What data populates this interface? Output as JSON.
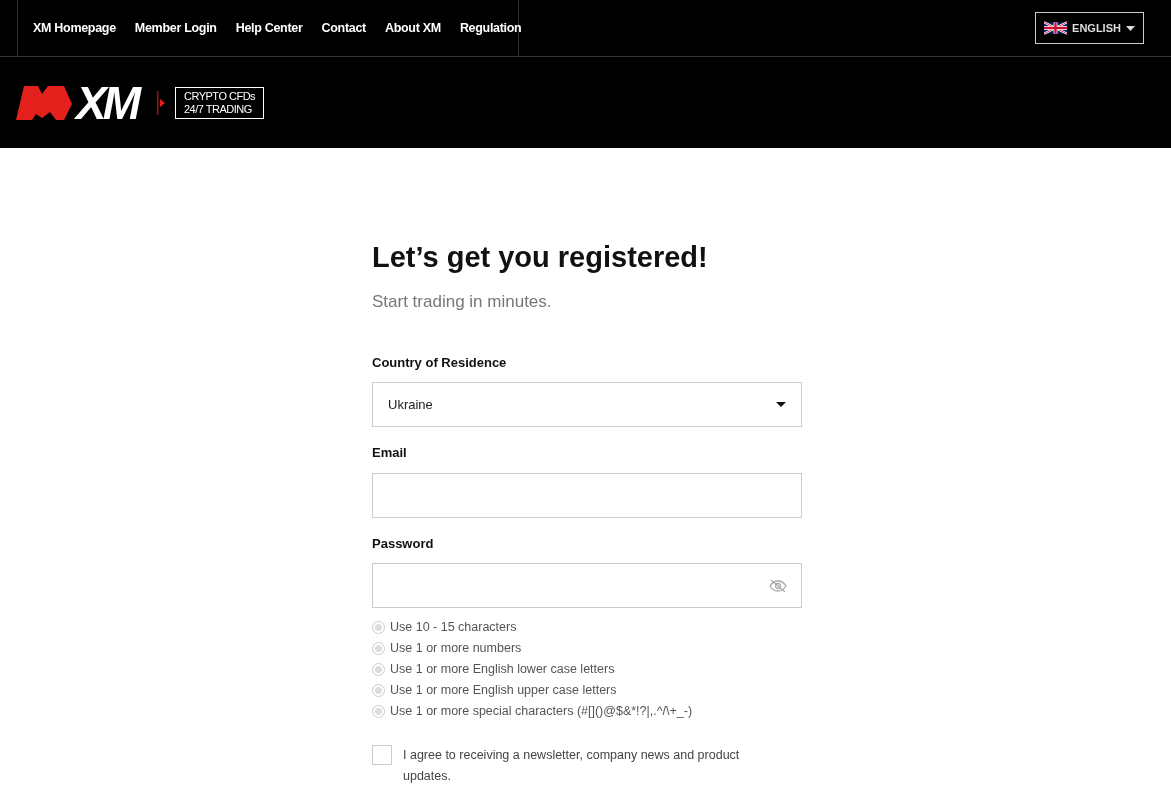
{
  "top_nav": {
    "links": [
      "XM Homepage",
      "Member Login",
      "Help Center",
      "Contact",
      "About XM",
      "Regulation"
    ],
    "language": "ENGLISH"
  },
  "header": {
    "logo": "XM",
    "badge_lines": [
      "CRYPTO CFDs",
      "24/7 TRADING"
    ]
  },
  "form": {
    "title": "Let’s get you registered!",
    "subtitle": "Start trading in minutes.",
    "fields": [
      {
        "kind": "select",
        "label": "Country of Residence",
        "value": "Ukraine"
      },
      {
        "kind": "text",
        "label": "Email"
      },
      {
        "kind": "password",
        "label": "Password"
      }
    ],
    "password_rules": [
      {
        "text": "Use 10 - 15 characters",
        "met": false
      },
      {
        "text": "Use 1 or more numbers",
        "met": false
      },
      {
        "text": "Use 1 or more English lower case letters",
        "met": false
      },
      {
        "text": "Use 1 or more English upper case letters",
        "met": false
      },
      {
        "text": "Use 1 or more special characters (#[]()@$&*!?|,.^/\\+_-)",
        "met": false
      }
    ],
    "newsletter": {
      "label": "I agree to receiving a newsletter, company news and product updates.",
      "checked": false
    }
  }
}
